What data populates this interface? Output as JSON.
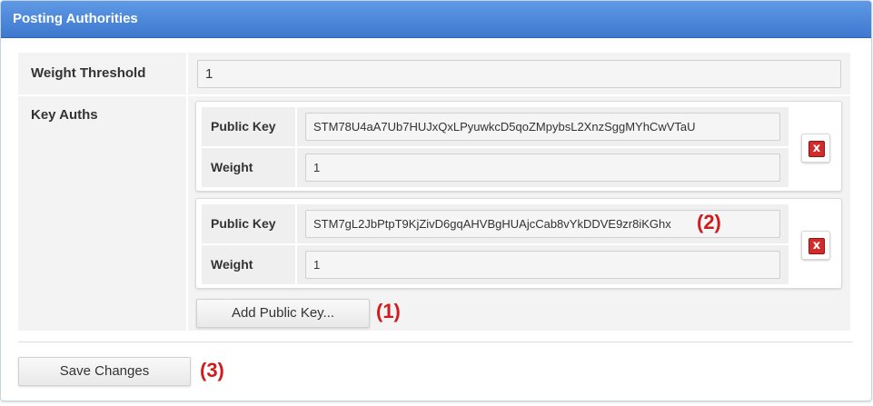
{
  "panel": {
    "title": "Posting Authorities"
  },
  "weight_threshold": {
    "label": "Weight Threshold",
    "value": "1"
  },
  "key_auths": {
    "label": "Key Auths",
    "entries": [
      {
        "public_key_label": "Public Key",
        "public_key": "STM78U4aA7Ub7HUJxQxLPyuwkcD5qoZMpybsL2XnzSggMYhCwVTaU",
        "weight_label": "Weight",
        "weight": "1",
        "delete_icon": "x"
      },
      {
        "public_key_label": "Public Key",
        "public_key": "STM7gL2JbPtpT9KjZivD6gqAHVBgHUAjcCab8vYkDDVE9zr8iKGhx",
        "weight_label": "Weight",
        "weight": "1",
        "delete_icon": "x"
      }
    ],
    "add_button": "Add Public Key..."
  },
  "save_button": "Save Changes",
  "annotations": {
    "add": "(1)",
    "key": "(2)",
    "save": "(3)"
  },
  "colors": {
    "header": "#4a86d8",
    "annotation": "#d01c1c",
    "delete": "#d12b2b"
  }
}
